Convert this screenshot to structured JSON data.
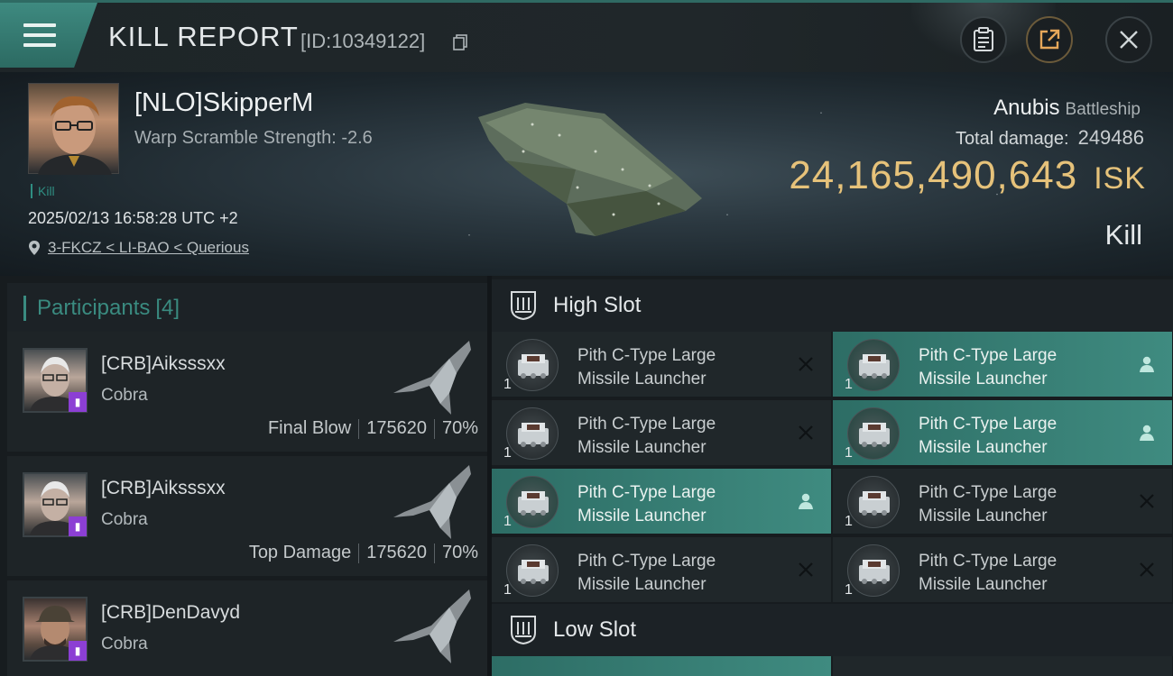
{
  "header": {
    "title": "KILL REPORT",
    "report_id": "[ID:10349122]",
    "icons": [
      "menu-icon",
      "copy-icon",
      "clipboard-icon",
      "share-icon",
      "close-icon"
    ]
  },
  "victim": {
    "name": "[NLO]SkipperM",
    "warp_scramble": "Warp Scramble Strength: -2.6",
    "tag": "Kill",
    "time": "2025/02/13 16:58:28 UTC +2",
    "location": "3-FKCZ < LI-BAO < Querious",
    "ship_name": "Anubis",
    "ship_class": "Battleship",
    "total_damage_label": "Total damage:",
    "total_damage": "249486",
    "isk_value": "24,165,490,643",
    "isk_unit": "ISK",
    "result": "Kill"
  },
  "participants": {
    "label": "Participants",
    "count": "[4]",
    "rows": [
      {
        "name": "[CRB]Aiksssxx",
        "ship": "Cobra",
        "role": "Final Blow",
        "damage": "175620",
        "percent": "70%"
      },
      {
        "name": "[CRB]Aiksssxx",
        "ship": "Cobra",
        "role": "Top Damage",
        "damage": "175620",
        "percent": "70%"
      },
      {
        "name": "[CRB]DenDavyd",
        "ship": "Cobra",
        "role": "",
        "damage": "",
        "percent": ""
      }
    ]
  },
  "slots": {
    "high_slot_label": "High Slot",
    "low_slot_label": "Low Slot",
    "high_items": [
      {
        "name": "Pith C-Type Large\nMissile Launcher",
        "qty": "1",
        "status": "destroyed",
        "highlight": false
      },
      {
        "name": "Pith C-Type Large\nMissile Launcher",
        "qty": "1",
        "status": "dropped",
        "highlight": true
      },
      {
        "name": "Pith C-Type Large\nMissile Launcher",
        "qty": "1",
        "status": "destroyed",
        "highlight": false
      },
      {
        "name": "Pith C-Type Large\nMissile Launcher",
        "qty": "1",
        "status": "dropped",
        "highlight": true
      },
      {
        "name": "Pith C-Type Large\nMissile Launcher",
        "qty": "1",
        "status": "dropped",
        "highlight": true
      },
      {
        "name": "Pith C-Type Large\nMissile Launcher",
        "qty": "1",
        "status": "destroyed",
        "highlight": false
      },
      {
        "name": "Pith C-Type Large\nMissile Launcher",
        "qty": "1",
        "status": "destroyed",
        "highlight": false
      },
      {
        "name": "Pith C-Type Large\nMissile Launcher",
        "qty": "1",
        "status": "destroyed",
        "highlight": false
      }
    ]
  },
  "colors": {
    "accent": "#3f8b80",
    "isk": "#e6c27a",
    "badge": "#8c3fd4"
  }
}
